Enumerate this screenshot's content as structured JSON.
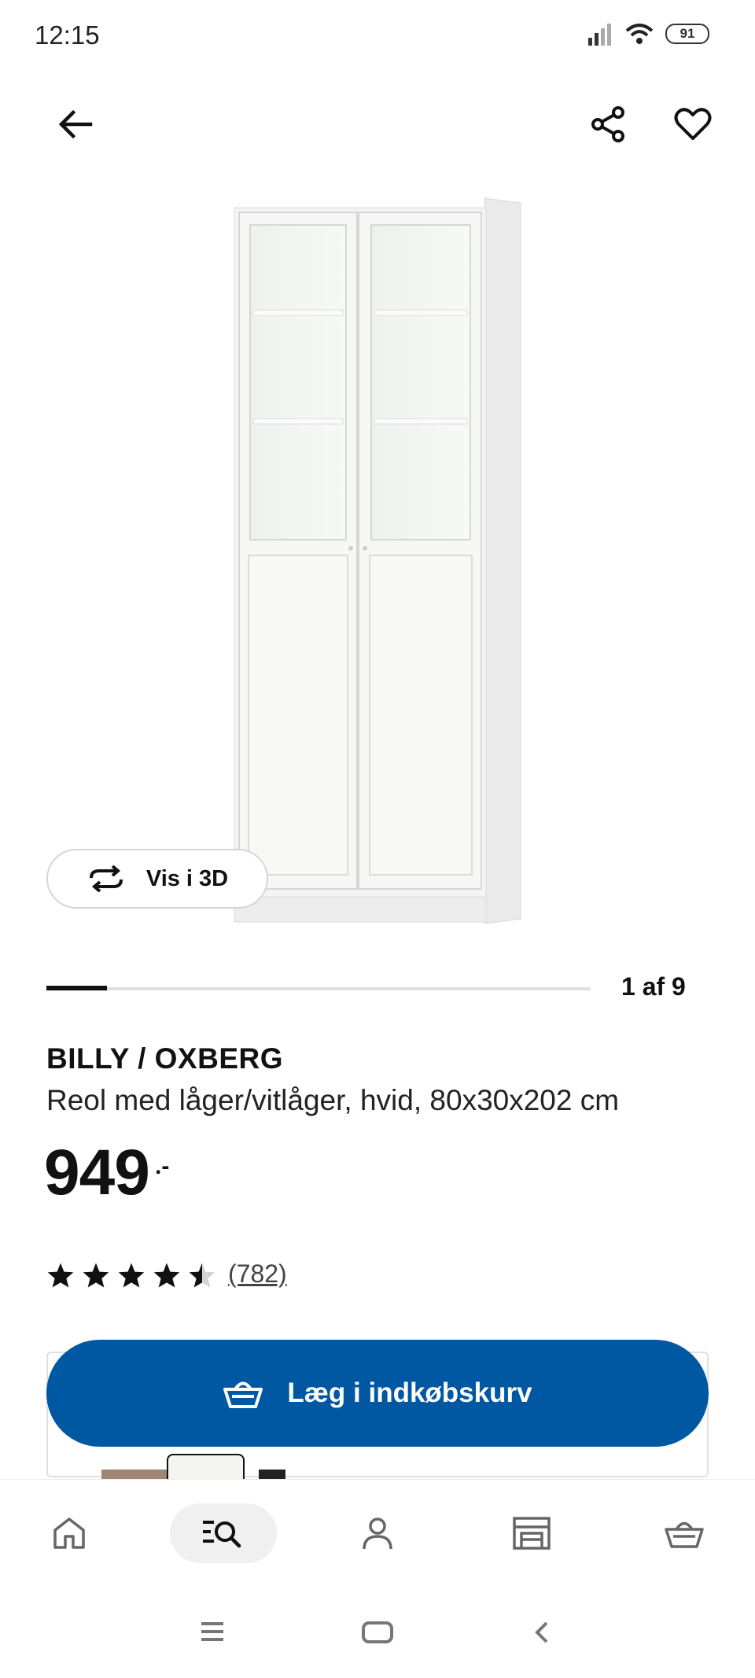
{
  "status_bar": {
    "time": "12:15",
    "battery": "91"
  },
  "header": {
    "back_icon": "arrow-left-icon",
    "share_icon": "share-icon",
    "favorite_icon": "heart-icon"
  },
  "product": {
    "image_alt": "BILLY / OXBERG bookcase with doors",
    "view_3d_label": "Vis i 3D",
    "carousel": {
      "current": 1,
      "total": 9,
      "counter_text": "1 af 9"
    },
    "name": "BILLY / OXBERG",
    "description": "Reol med låger/vitlåger, hvid, 80x30x202 cm",
    "price": "949",
    "price_suffix": ".-",
    "rating": {
      "stars": 4.5,
      "max": 5,
      "review_count_text": "(782)"
    }
  },
  "cart_button": {
    "label": "Læg i indkøbskurv",
    "icon": "basket-icon"
  },
  "colors": {
    "brand_blue": "#0058a3",
    "text": "#111111"
  },
  "bottom_nav": {
    "items": [
      {
        "name": "home",
        "icon": "home-icon"
      },
      {
        "name": "search",
        "icon": "search-icon",
        "active": true
      },
      {
        "name": "profile",
        "icon": "person-icon"
      },
      {
        "name": "store",
        "icon": "store-icon"
      },
      {
        "name": "cart",
        "icon": "basket-icon"
      }
    ]
  },
  "system_nav": {
    "menu_icon": "menu-icon",
    "home_icon": "home-square-icon",
    "back_icon": "chevron-left-icon"
  }
}
